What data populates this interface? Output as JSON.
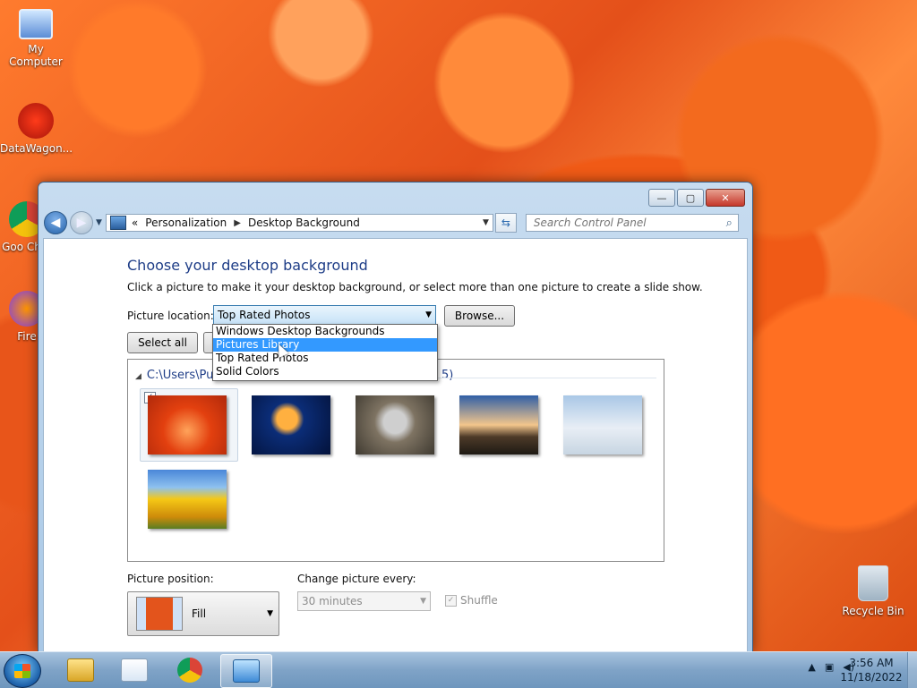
{
  "desktop": {
    "icons": [
      {
        "label": "My Computer"
      },
      {
        "label": "DataWagon..."
      },
      {
        "label": "Goo Chro"
      },
      {
        "label": "Fire"
      },
      {
        "label": "Recycle Bin"
      }
    ]
  },
  "window": {
    "controls": {
      "minimize": "—",
      "maximize": "▢",
      "close": "✕"
    },
    "breadcrumb": {
      "overflow": "«",
      "items": [
        "Personalization",
        "Desktop Background"
      ],
      "separator": "▶"
    },
    "search_placeholder": "Search Control Panel",
    "title": "Choose your desktop background",
    "description": "Click a picture to make it your desktop background, or select more than one picture to create a slide show.",
    "picture_location": {
      "label": "Picture location:",
      "value": "Top Rated Photos",
      "options": [
        "Windows Desktop Backgrounds",
        "Pictures Library",
        "Top Rated Photos",
        "Solid Colors"
      ],
      "highlighted": "Pictures Library"
    },
    "browse_label": "Browse...",
    "select_all_label": "Select all",
    "group_header": "C:\\Users\\Pu",
    "group_header_tail": "5)",
    "thumbnails": [
      {
        "name": "Flower",
        "selected": true
      },
      {
        "name": "Jellyfish",
        "selected": false
      },
      {
        "name": "Koala",
        "selected": false
      },
      {
        "name": "Lighthouse",
        "selected": false
      },
      {
        "name": "Penguins",
        "selected": false
      },
      {
        "name": "Tulips",
        "selected": false
      }
    ],
    "picture_position": {
      "label": "Picture position:",
      "value": "Fill"
    },
    "change_picture": {
      "label": "Change picture every:",
      "value": "30 minutes"
    },
    "shuffle_label": "Shuffle"
  },
  "taskbar": {
    "items": [
      "Windows Explorer",
      "Windows Media Player",
      "Google Chrome",
      "Control Panel"
    ],
    "active": "Control Panel",
    "time": "3:56 AM",
    "date": "11/18/2022"
  },
  "colors": {
    "accent": "#1e3d87",
    "highlight": "#3399ff"
  }
}
